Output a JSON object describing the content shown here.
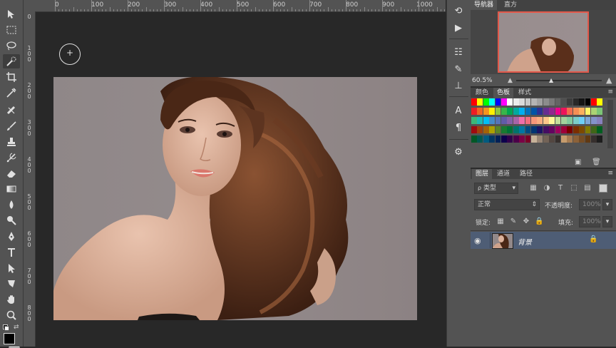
{
  "ruler_top": {
    "labels": [
      "0",
      "100",
      "200",
      "300",
      "400",
      "500",
      "600",
      "700",
      "800",
      "900",
      "1000"
    ]
  },
  "ruler_left": {
    "labels": [
      "0",
      "1 0 0",
      "2 0 0",
      "3 0 0",
      "4 0 0",
      "5 0 0",
      "6 0 0",
      "7 0 0",
      "8 0 0"
    ]
  },
  "navigator": {
    "tabs": [
      "导航器",
      "直方"
    ],
    "zoom": "60.5%"
  },
  "swatches_panel": {
    "tabs": [
      "颜色",
      "色板",
      "样式"
    ],
    "active_tab": "色板",
    "colors": {
      "row1": [
        "#ff0000",
        "#ffff00",
        "#00ff00",
        "#00ffff",
        "#0000ff",
        "#ff00ff",
        "#ffffff",
        "#ececec",
        "#dadada",
        "#c8c8c8",
        "#b4b4b4",
        "#a0a0a0",
        "#8c8c8c",
        "#787878",
        "#646464",
        "#505050",
        "#3c3c3c",
        "#282828",
        "#141414",
        "#000000",
        "#ff0000",
        "#ffff00"
      ],
      "row2": [
        "#ee1d24",
        "#f26522",
        "#f7941d",
        "#fff200",
        "#8dc63f",
        "#39b54a",
        "#00a651",
        "#00a99d",
        "#00aeef",
        "#0072bc",
        "#0054a6",
        "#2e3192",
        "#662d91",
        "#92278f",
        "#ec008c",
        "#ed145b",
        "#f26c4f",
        "#f68e55",
        "#fbaf5d",
        "#fff568",
        "#acd373",
        "#7cc576"
      ],
      "row3": [
        "#3cb878",
        "#1cbbb4",
        "#00bff3",
        "#448ccb",
        "#5674b9",
        "#605ca8",
        "#8560a8",
        "#a864a8",
        "#f06eaa",
        "#f26d7d",
        "#f7977a",
        "#f9ad81",
        "#fdc68a",
        "#fff79a",
        "#c4df9b",
        "#a3d39c",
        "#82ca9d",
        "#7bcdc8",
        "#6ecff6",
        "#7ea7d8",
        "#8393ca",
        "#8781bd"
      ],
      "row4": [
        "#9e0b0f",
        "#a0410d",
        "#a36209",
        "#aba000",
        "#598527",
        "#197b30",
        "#007236",
        "#00746b",
        "#0076a3",
        "#004a80",
        "#003471",
        "#1b1464",
        "#440e62",
        "#630460",
        "#9e005d",
        "#9e0039",
        "#790000",
        "#7b2e00",
        "#7d4900",
        "#827b00",
        "#406618",
        "#005e20"
      ],
      "row5": [
        "#005826",
        "#005952",
        "#005b7f",
        "#003663",
        "#002157",
        "#0d004c",
        "#32004b",
        "#4b0049",
        "#7b0046",
        "#7a0026",
        "#c7b299",
        "#998675",
        "#736357",
        "#534741",
        "#37302d",
        "#c69c6d",
        "#a67c52",
        "#8c6239",
        "#754c24",
        "#603913",
        "#362f2d",
        "#1d1d1d"
      ]
    }
  },
  "layers_panel": {
    "tabs": [
      "图层",
      "通道",
      "路径"
    ],
    "active_tab": "图层",
    "filter_kind": "类型",
    "blend_mode": "正常",
    "opacity_label": "不透明度:",
    "opacity_value": "100%",
    "lock_label": "锁定:",
    "fill_label": "填充:",
    "fill_value": "100%",
    "layers": [
      {
        "name": "背景",
        "visible": true,
        "locked": true
      }
    ]
  }
}
